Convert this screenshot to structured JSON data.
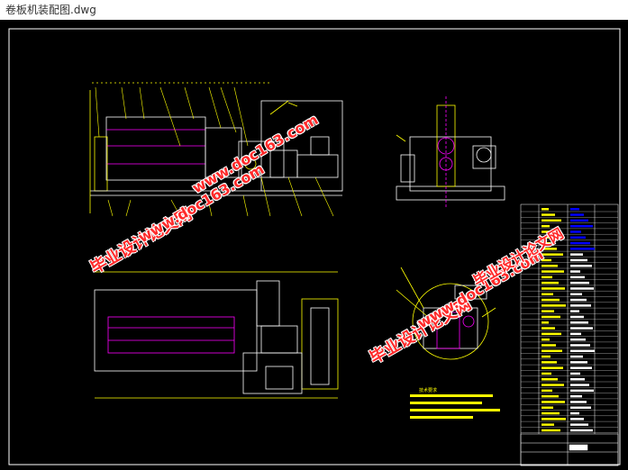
{
  "window": {
    "title": "卷板机装配图.dwg"
  },
  "watermarks": [
    {
      "text": "毕业设计论文网",
      "id": "wm1"
    },
    {
      "text": "www.doc163.com",
      "id": "wm2"
    },
    {
      "text": "毕业设计论文网",
      "id": "wm3"
    },
    {
      "text": "www.doc163.com",
      "id": "wm4"
    },
    {
      "text": "毕业设计论文网",
      "id": "wm5"
    },
    {
      "text": "www.doc163.com",
      "id": "wm6"
    }
  ],
  "notes": {
    "tech_requirements_title": "技术要求"
  },
  "colors": {
    "background": "#000000",
    "lines": "#ffffff",
    "highlight": "#ffff00",
    "accent": "#ff00ff",
    "blue": "#0000ff",
    "watermark": "#ff2a2a"
  }
}
